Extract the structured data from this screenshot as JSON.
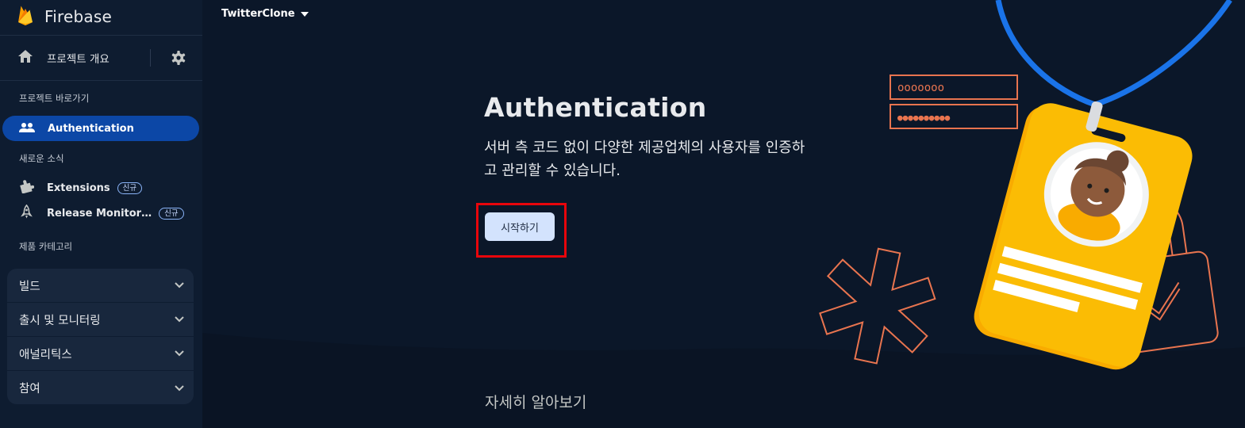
{
  "brand": {
    "name": "Firebase"
  },
  "sidebar": {
    "overview_label": "프로젝트 개요",
    "shortcuts_label": "프로젝트 바로가기",
    "active_item": {
      "label": "Authentication"
    },
    "whats_new_label": "새로운 소식",
    "new_items": [
      {
        "label": "Extensions",
        "badge": "신규"
      },
      {
        "label": "Release Monitor…",
        "badge": "신규"
      }
    ],
    "categories_label": "제품 카테고리",
    "categories": [
      {
        "label": "빌드"
      },
      {
        "label": "출시 및 모니터링"
      },
      {
        "label": "애널리틱스"
      },
      {
        "label": "참여"
      }
    ]
  },
  "header": {
    "project_name": "TwitterClone"
  },
  "main": {
    "title": "Authentication",
    "description": "서버 측 코드 없이 다양한 제공업체의 사용자를 인증하고 관리할 수 있습니다.",
    "start_button": "시작하기",
    "learn_more": "자세히 알아보기"
  },
  "illustration": {
    "username_field": "ooooooo",
    "password_field": "●●●●●●●●●●"
  },
  "colors": {
    "background": "#0b1729",
    "sidebar": "#0e1c30",
    "active_nav": "#0c47a6",
    "primary_button": "#d3e3fd",
    "highlight_box": "#e8050b",
    "accent_orange": "#e8744f",
    "badge_yellow": "#fbbc04",
    "lanyard_blue": "#1a73e8"
  }
}
